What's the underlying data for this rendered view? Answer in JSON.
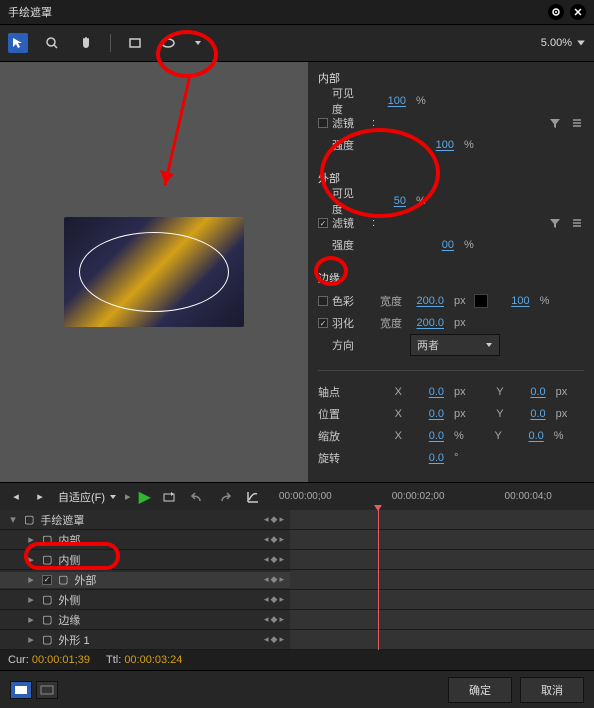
{
  "title": "手绘遮罩",
  "toolbar": {
    "zoom": "5.00%"
  },
  "props": {
    "inner": {
      "title": "内部",
      "visibility_label": "可见度",
      "visibility": "100",
      "filter_label": "滤镜",
      "filter_sep": ":",
      "strength_label": "强度",
      "strength": "100"
    },
    "outer": {
      "title": "外部",
      "visibility_label": "可见度",
      "visibility": "50",
      "filter_label": "滤镜",
      "filter_sep": ":",
      "strength_label": "强度",
      "strength": "00"
    },
    "edge": {
      "title": "边缘",
      "color_label": "色彩",
      "width_label": "宽度",
      "width1": "200.0",
      "pct": "100",
      "soften_label": "羽化",
      "width2": "200.0",
      "dir_label": "方向",
      "dir_value": "两者"
    },
    "transform": {
      "pivot_label": "轴点",
      "pos_label": "位置",
      "scale_label": "缩放",
      "rot_label": "旋转",
      "x0": "0.0",
      "y0": "0.0",
      "sx": "0.0",
      "sy": "0.0",
      "rot": "0.0"
    }
  },
  "timeline": {
    "fit_label": "自适应(F)",
    "t0": "00:00:00;00",
    "t2": "00:00:02;00",
    "t4": "00:00:04;0"
  },
  "tracks": {
    "root": "手绘遮罩",
    "inner": "内部",
    "inner2": "内侧",
    "outer": "外部",
    "outer2": "外侧",
    "edge": "边缘",
    "shape": "外形 1"
  },
  "status": {
    "cur_label": "Cur:",
    "cur": "00:00:01;39",
    "ttl_label": "Ttl:",
    "ttl": "00:00:03:24"
  },
  "footer": {
    "ok": "确定",
    "cancel": "取消"
  }
}
